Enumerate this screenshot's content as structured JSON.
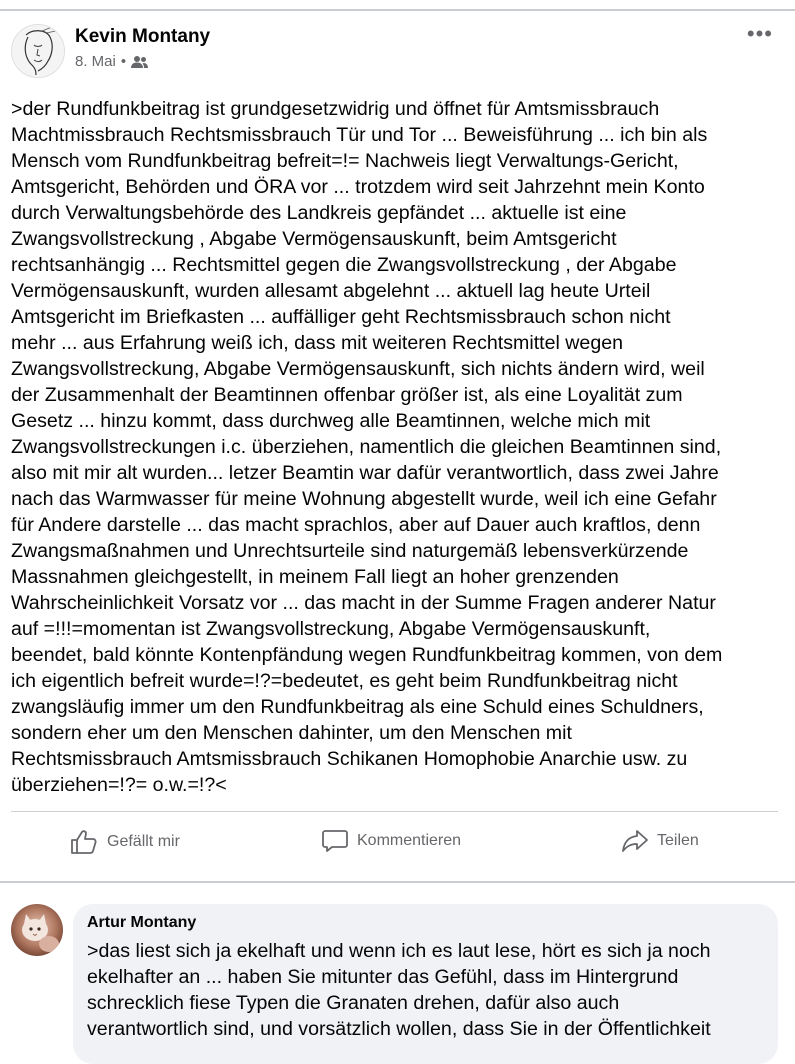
{
  "post": {
    "author": "Kevin Montany",
    "date": "8. Mai",
    "separator": "•",
    "audience_icon": "friends-icon",
    "more_icon": "more-options-icon",
    "more_label": "•••",
    "text": ">der Rundfunkbeitrag ist grundgesetzwidrig und öffnet für Amtsmissbrauch\nMachtmissbrauch Rechtsmissbrauch Tür und Tor ... Beweisführung ... ich bin als\nMensch vom Rundfunkbeitrag befreit=!= Nachweis liegt Verwaltungs-Gericht,\nAmtsgericht,  Behörden und ÖRA vor  ... trotzdem wird seit Jahrzehnt mein Konto\ndurch Verwaltungsbehörde des Landkreis gepfändet ... aktuelle ist eine\nZwangsvollstreckung , Abgabe Vermögensauskunft, beim Amtsgericht\nrechtsanhängig ... Rechtsmittel gegen die Zwangsvollstreckung , der Abgabe\nVermögensauskunft,  wurden allesamt abgelehnt ... aktuell lag heute Urteil\nAmtsgericht im Briefkasten ... auffälliger geht Rechtsmissbrauch schon nicht\nmehr ... aus Erfahrung weiß ich, dass mit weiteren Rechtsmittel wegen\nZwangsvollstreckung, Abgabe Vermögensauskunft, sich nichts ändern wird, weil\nder Zusammenhalt der Beamtinnen offenbar größer ist, als eine Loyalität zum\nGesetz  ... hinzu kommt, dass durchweg alle Beamtinnen, welche  mich mit\nZwangsvollstreckungen i.c. überziehen, namentlich die  gleichen Beamtinnen sind,\nalso mit mir alt wurden... letzer Beamtin war dafür verantwortlich, dass zwei Jahre\nnach das Warmwasser für meine Wohnung abgestellt wurde, weil ich eine Gefahr\nfür Andere darstelle ... das macht sprachlos, aber auf Dauer auch kraftlos, denn\nZwangsmaßnahmen und Unrechtsurteile sind naturgemäß lebensverkürzende\nMassnahmen gleichgestellt, in meinem Fall liegt an hoher grenzenden\nWahrscheinlichkeit Vorsatz  vor ... das macht in der Summe Fragen anderer Natur\nauf =!!!=momentan ist Zwangsvollstreckung, Abgabe Vermögensauskunft,\nbeendet, bald könnte Kontenpfändung wegen Rundfunkbeitrag kommen, von dem\nich eigentlich befreit wurde=!?=bedeutet, es geht beim Rundfunkbeitrag nicht\nzwangsläufig immer um den Rundfunkbeitrag als eine Schuld eines Schuldners,\nsondern eher um den Menschen dahinter, um den Menschen mit\nRechtsmissbrauch Amtsmissbrauch Schikanen Homophobie Anarchie usw. zu\nüberziehen=!?= o.w.=!?<"
  },
  "actions": {
    "like": {
      "label": "Gefällt mir",
      "icon": "thumbs-up-icon"
    },
    "comment": {
      "label": "Kommentieren",
      "icon": "comment-icon"
    },
    "share": {
      "label": "Teilen",
      "icon": "share-icon"
    }
  },
  "comment": {
    "author": "Artur Montany",
    "text": ">das liest sich ja ekelhaft und wenn ich es laut lese, hört es sich ja noch\nekelhafter an ... haben Sie mitunter das Gefühl, dass im Hintergrund\nschrecklich fiese Typen die Granaten drehen, dafür also auch\nverantwortlich sind, und vorsätzlich wollen, dass Sie in der Öffentlichkeit"
  },
  "colors": {
    "text": "#050505",
    "secondary_text": "#65676b",
    "comment_bubble": "#f0f2f5",
    "divider": "#ced0d4"
  }
}
